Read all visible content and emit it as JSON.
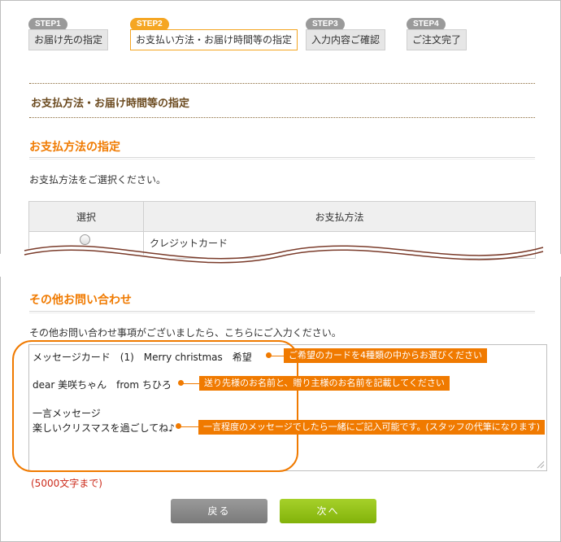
{
  "steps": [
    {
      "badge": "STEP1",
      "label": "お届け先の指定"
    },
    {
      "badge": "STEP2",
      "label": "お支払い方法・お届け時間等の指定"
    },
    {
      "badge": "STEP3",
      "label": "入力内容ご確認"
    },
    {
      "badge": "STEP4",
      "label": "ご注文完了"
    }
  ],
  "page_title": "お支払方法・お届け時間等の指定",
  "payment": {
    "heading": "お支払方法の指定",
    "instruction": "お支払方法をご選択ください。",
    "col_select": "選択",
    "col_method": "お支払方法",
    "option_credit": "クレジットカード"
  },
  "inquiry": {
    "heading": "その他お問い合わせ",
    "instruction": "その他お問い合わせ事項がございましたら、こちらにご入力ください。",
    "lines": [
      "メッセージカード　(1)　Merry christmas　希望",
      "dear 美咲ちゃん　from ちひろ",
      "一言メッセージ",
      "楽しいクリスマスを過ごしてね♪"
    ],
    "limit": "(5000文字まで)"
  },
  "callouts": [
    "ご希望のカードを4種類の中からお選びください",
    "送り先様のお名前と、贈り主様のお名前を記載してください",
    "一言程度のメッセージでしたら一緒にご記入可能です。(スタッフの代筆になります)"
  ],
  "buttons": {
    "back": "戻る",
    "next": "次へ"
  },
  "colors": {
    "accent": "#f07a00",
    "step_active": "#f5a623",
    "next_button": "#8dbc14"
  }
}
